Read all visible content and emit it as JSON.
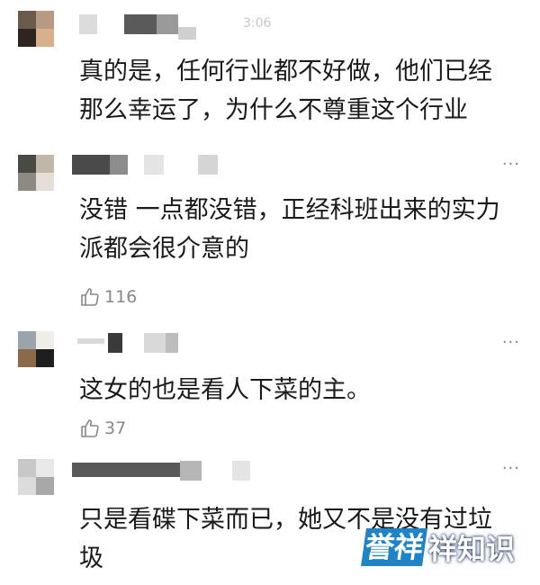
{
  "comments": [
    {
      "timestamp": "3:06",
      "text": "真的是，任何行业都不好做，他们已经\n那么幸运了，为什么不尊重这个行业",
      "likes": ""
    },
    {
      "text": "没错 一点都没错，正经科班出来的实力\n派都会很介意的",
      "likes": "116"
    },
    {
      "text": "这女的也是看人下菜的主。",
      "likes": "37"
    },
    {
      "text": "只是看碟下菜而已，她又不是没有过垃\n圾",
      "likes": ""
    }
  ],
  "more_icon": "···",
  "like_icon": "thumbs-up-icon",
  "watermark": {
    "box_text": "誉祥",
    "text": "祥知识"
  }
}
